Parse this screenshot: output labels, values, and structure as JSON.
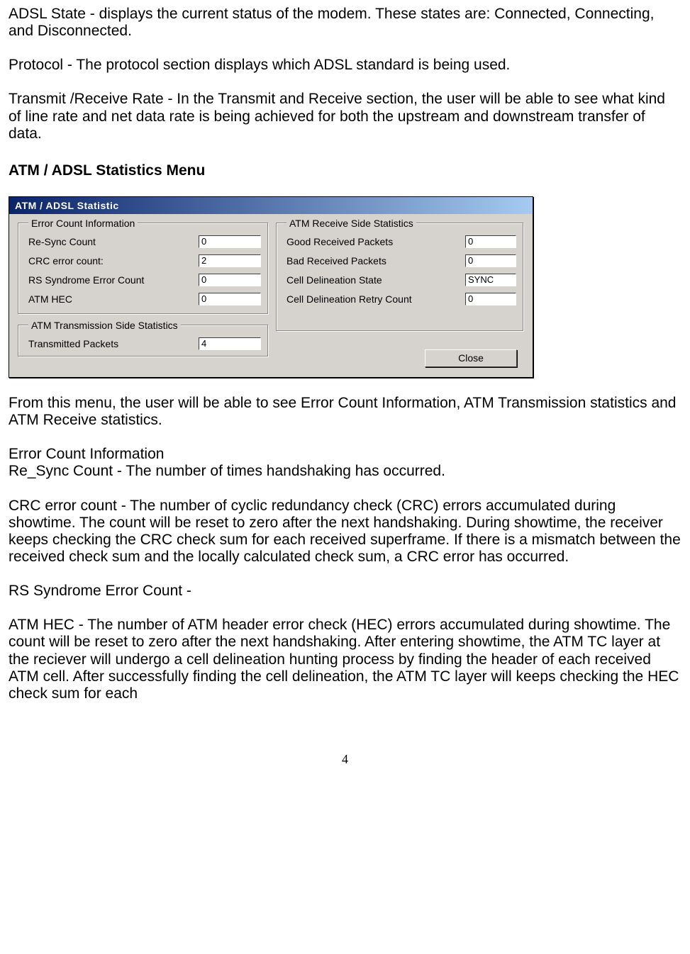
{
  "doc": {
    "p1": "ADSL State - displays the current status of the modem.  These states are: Connected, Connecting, and Disconnected.",
    "p2": "Protocol - The protocol section displays which ADSL standard is being used.",
    "p3": "Transmit /Receive Rate - In the Transmit and Receive section, the user will be able to see what kind of line rate and net data rate is being achieved for both the upstream and downstream transfer of data.",
    "heading": "ATM / ADSL Statistics Menu",
    "p4": "From this menu, the user will be able to see Error Count Information, ATM Transmission statistics and ATM Receive statistics.",
    "p5": "Error Count Information",
    "p6": "Re_Sync Count - The number of times handshaking has occurred.",
    "p7": "CRC error count - The number of cyclic redundancy check (CRC) errors accumulated during showtime. The count will be reset to zero after the next handshaking. During showtime, the receiver keeps checking the CRC check sum for each received superframe. If there is a mismatch between the received check sum and the locally calculated check sum, a CRC error has occurred.",
    "p8": "RS Syndrome Error Count -",
    "p9": "ATM HEC - The number of ATM header error check (HEC) errors accumulated during showtime. The count will be reset to zero after the next handshaking. After entering showtime, the ATM TC layer at the reciever will undergo a cell delineation hunting process by finding the header of each received ATM cell. After successfully finding the cell delineation, the ATM TC layer will keeps checking the HEC check sum for each",
    "page_number": "4"
  },
  "dialog": {
    "title": "ATM / ADSL Statistic",
    "error_count": {
      "legend": "Error Count Information",
      "rows": [
        {
          "label": "Re-Sync Count",
          "value": "0"
        },
        {
          "label": "CRC error count:",
          "value": "2"
        },
        {
          "label": "RS Syndrome Error Count",
          "value": "0"
        },
        {
          "label": "ATM HEC",
          "value": "0"
        }
      ]
    },
    "atm_rx": {
      "legend": "ATM Receive Side Statistics",
      "rows": [
        {
          "label": "Good Received Packets",
          "value": "0"
        },
        {
          "label": "Bad Received  Packets",
          "value": "0"
        },
        {
          "label": "Cell Delineation State",
          "value": "SYNC"
        },
        {
          "label": "Cell Delineation Retry Count",
          "value": "0"
        }
      ]
    },
    "atm_tx": {
      "legend": "ATM Transmission Side Statistics",
      "rows": [
        {
          "label": "Transmitted Packets",
          "value": "4"
        }
      ]
    },
    "close_label": "Close"
  }
}
